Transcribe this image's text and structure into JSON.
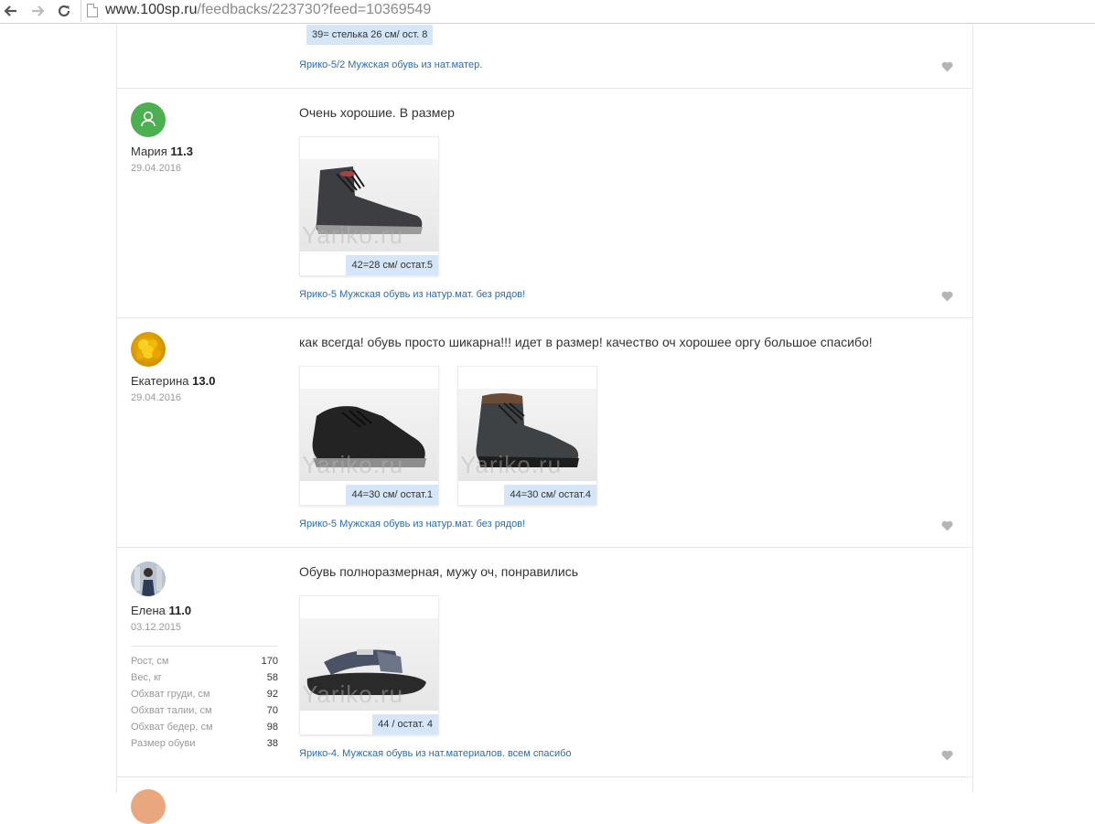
{
  "browser": {
    "url_host": "www.100sp.ru",
    "url_path": "/feedbacks/223730?feed=10369549"
  },
  "top_partial": {
    "size_label": "39= стелька 26 см/ ост. 8",
    "product_link": "Ярико-5/2 Мужская обувь из нат.матер."
  },
  "reviews": [
    {
      "name": "Мария",
      "rating": "11.3",
      "date": "29.04.2016",
      "avatar_color": "#4caf50",
      "text": "Очень хорошие. В размер",
      "photos": [
        {
          "label": "42=28 см/ остат.5",
          "watermark": "Yariko.ru"
        }
      ],
      "product_link": "Ярико-5 Мужская обувь из натур.мат. без рядов!"
    },
    {
      "name": "Екатерина",
      "rating": "13.0",
      "date": "29.04.2016",
      "text": "как всегда! обувь просто шикарна!!! идет в размер! качество оч хорошее оргу большое спасибо!",
      "photos": [
        {
          "label": "44=30 см/ остат.1",
          "watermark": "Yariko.ru"
        },
        {
          "label": "44=30 см/ остат.4",
          "watermark": "Yariko.ru"
        }
      ],
      "product_link": "Ярико-5 Мужская обувь из натур.мат. без рядов!"
    },
    {
      "name": "Елена",
      "rating": "11.0",
      "date": "03.12.2015",
      "text": "Обувь полноразмерная, мужу оч, понравились",
      "photos": [
        {
          "label": "44 / остат. 4",
          "watermark": "Yariko.ru"
        }
      ],
      "product_link": "Ярико-4. Мужская обувь из нат.материалов. всем спасибо",
      "stats": [
        {
          "label": "Рост, см",
          "value": "170"
        },
        {
          "label": "Вес, кг",
          "value": "58"
        },
        {
          "label": "Обхват груди, см",
          "value": "92"
        },
        {
          "label": "Обхват талии, см",
          "value": "70"
        },
        {
          "label": "Обхват бедер, см",
          "value": "98"
        },
        {
          "label": "Размер обуви",
          "value": "38"
        }
      ]
    }
  ],
  "colors": {
    "link": "#2a6db0",
    "label_bg": "#d4e6f8",
    "heart": "#b5b5b5"
  }
}
